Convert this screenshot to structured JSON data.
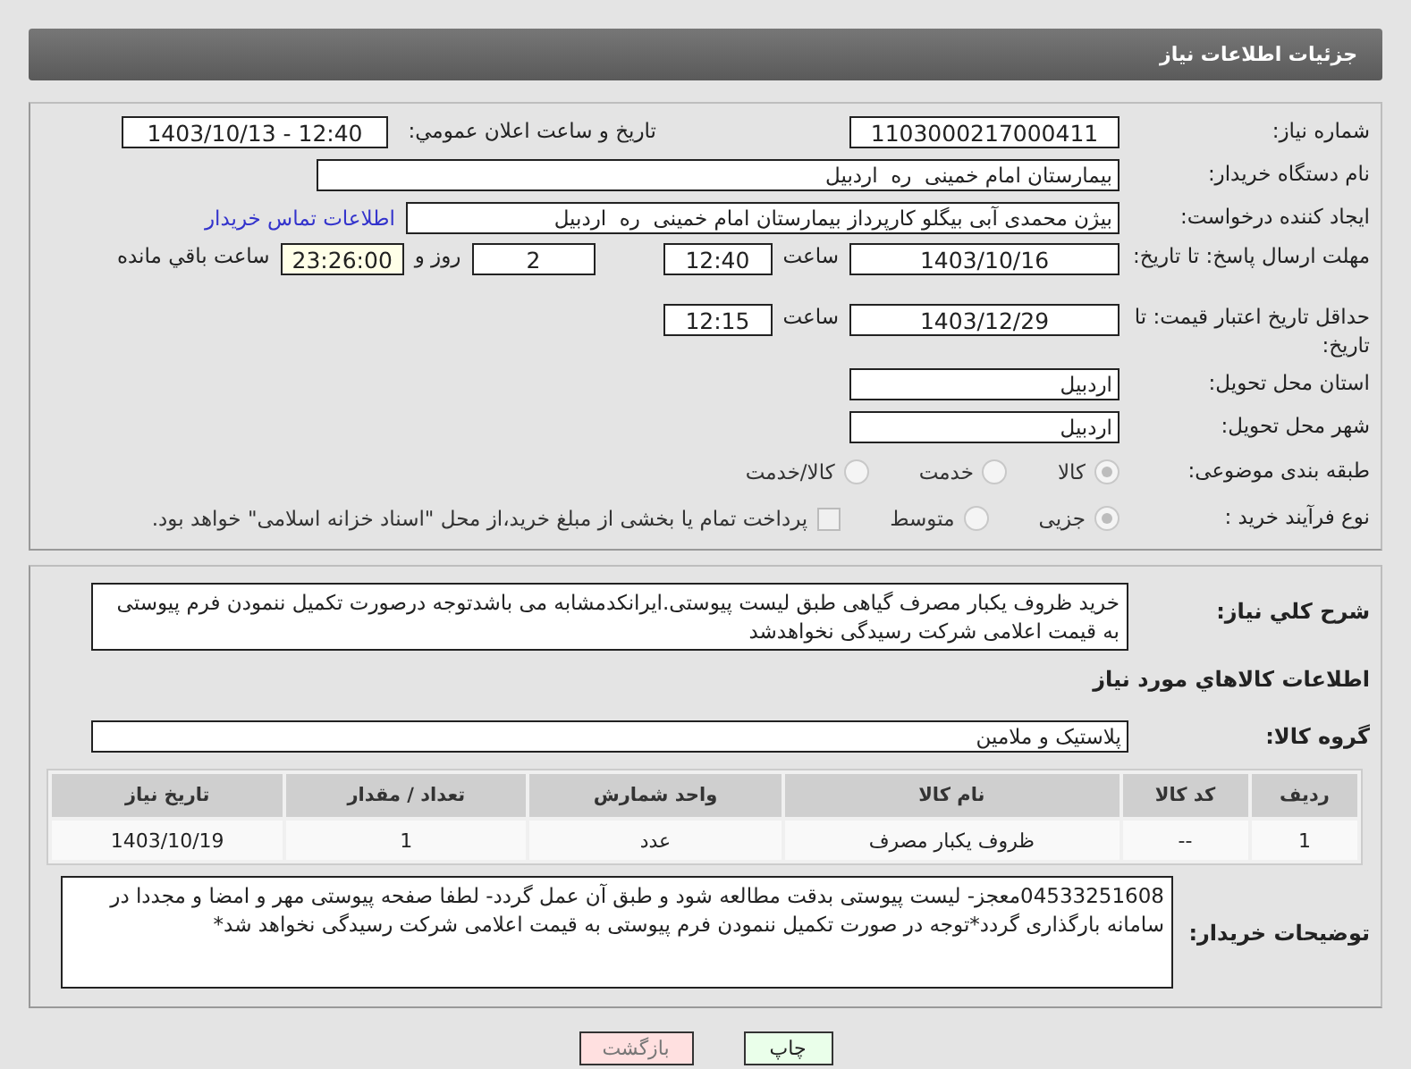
{
  "header": {
    "title": "جزئیات اطلاعات نیاز"
  },
  "form": {
    "need_number": {
      "label": "شماره نیاز:",
      "value": "1103000217000411"
    },
    "announce": {
      "label": "تاریخ و ساعت اعلان عمومي:",
      "value": "1403/10/13 - 12:40"
    },
    "buyer_org": {
      "label": "نام دستگاه خریدار:",
      "value": "بیمارستان امام خمینی  ره  اردبیل"
    },
    "creator": {
      "label": "ایجاد کننده درخواست:",
      "value": "بیژن محمدی آبی بیگلو کارپرداز بیمارستان امام خمینی  ره  اردبیل",
      "link": "اطلاعات تماس خریدار"
    },
    "deadline": {
      "label": "مهلت ارسال پاسخ: تا تاریخ:",
      "date": "1403/10/16",
      "time_label": "ساعت",
      "time": "12:40",
      "days": "2",
      "days_label": "روز و",
      "remaining": "23:26:00",
      "remaining_label": "ساعت باقي مانده"
    },
    "price_validity": {
      "label": "حداقل تاریخ اعتبار قیمت: تا تاریخ:",
      "date": "1403/12/29",
      "time_label": "ساعت",
      "time": "12:15"
    },
    "province": {
      "label": "استان محل تحویل:",
      "value": "اردبیل"
    },
    "city": {
      "label": "شهر محل تحویل:",
      "value": "اردبیل"
    },
    "category": {
      "label": "طبقه بندی موضوعی:",
      "options": [
        {
          "label": "کالا",
          "selected": true
        },
        {
          "label": "خدمت",
          "selected": false
        },
        {
          "label": "کالا/خدمت",
          "selected": false
        }
      ]
    },
    "process": {
      "label": "نوع فرآیند خرید :",
      "options": [
        {
          "label": "جزیی",
          "selected": true
        },
        {
          "label": "متوسط",
          "selected": false
        }
      ],
      "treasury": {
        "label": "پرداخت تمام یا بخشی از مبلغ خرید،از محل \"اسناد خزانه اسلامی\" خواهد بود.",
        "checked": false
      }
    }
  },
  "details": {
    "description": {
      "label": "شرح کلي نياز:",
      "value": "خرید ظروف یکبار مصرف گیاهی طبق لیست پیوستی.ایرانکدمشابه می باشدتوجه درصورت تکمیل ننمودن فرم پیوستی به قیمت اعلامی شرکت رسیدگی نخواهدشد"
    },
    "goods_heading": "اطلاعات کالاهاي مورد نياز",
    "goods_group": {
      "label": "گروه کالا:",
      "value": "پلاستیک و ملامین"
    },
    "table": {
      "columns": [
        "ردیف",
        "کد کالا",
        "نام کالا",
        "واحد شمارش",
        "تعداد / مقدار",
        "تاریخ نیاز"
      ],
      "rows": [
        [
          "1",
          "--",
          "ظروف یکبار مصرف",
          "عدد",
          "1",
          "1403/10/19"
        ]
      ]
    },
    "buyer_notes": {
      "label": "توضیحات خریدار:",
      "value": "04533251608معجز- لیست پیوستی بدقت مطالعه شود و طبق آن عمل گردد- لطفا صفحه پیوستی مهر و امضا و مجددا در سامانه بارگذاری گردد*توجه در صورت تکمیل ننمودن فرم پیوستی به قیمت اعلامی شرکت رسیدگی نخواهد شد*"
    }
  },
  "buttons": [
    {
      "label": "چاپ",
      "kind": "print"
    },
    {
      "label": "بازگشت",
      "kind": "back"
    }
  ]
}
